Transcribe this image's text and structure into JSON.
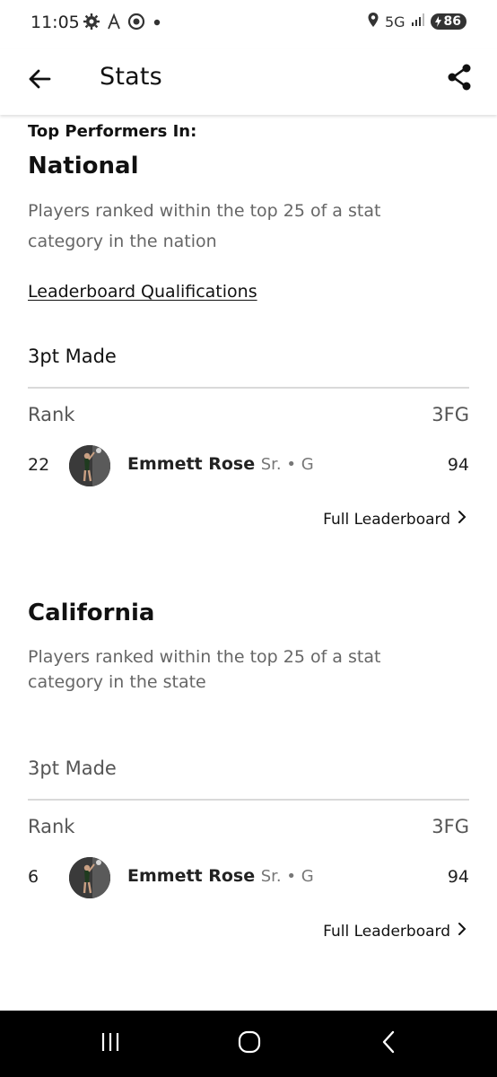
{
  "status_bar": {
    "time": "11:05",
    "network": "5G",
    "battery": "86",
    "icons": [
      "settings-gear-icon",
      "text-a-icon",
      "target-circle-icon",
      "dot-icon",
      "location-pin-icon",
      "signal-bars-icon",
      "battery-icon"
    ]
  },
  "app_bar": {
    "title": "Stats",
    "back_icon": "arrow-left-icon",
    "share_icon": "share-icon"
  },
  "content": {
    "top_label": "Top Performers In:",
    "sections": [
      {
        "title": "National",
        "description": "Players ranked within the top 25 of a stat category in the nation",
        "qualifications_link": "Leaderboard Qualifications",
        "category": "3pt Made",
        "columns": {
          "rank": "Rank",
          "stat": "3FG"
        },
        "players": [
          {
            "rank": "22",
            "name": "Emmett Rose",
            "meta": "Sr. • G",
            "value": "94"
          }
        ],
        "full_leaderboard": "Full Leaderboard"
      },
      {
        "title": "California",
        "description": "Players ranked within the top 25 of a stat category in the state",
        "category": "3pt Made",
        "columns": {
          "rank": "Rank",
          "stat": "3FG"
        },
        "players": [
          {
            "rank": "6",
            "name": "Emmett Rose",
            "meta": "Sr. • G",
            "value": "94"
          }
        ],
        "full_leaderboard": "Full Leaderboard"
      }
    ]
  },
  "nav_bar": {
    "icons": [
      "recent-apps-icon",
      "home-icon",
      "back-chevron-icon"
    ]
  },
  "colors": {
    "text_primary": "#111111",
    "text_secondary": "#666666",
    "divider": "#d9d9d9",
    "nav_background": "#000000"
  }
}
